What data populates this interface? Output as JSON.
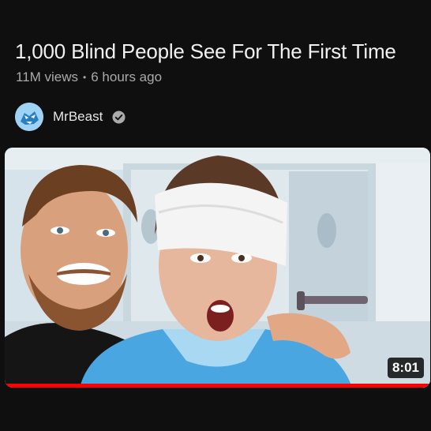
{
  "video": {
    "title": "1,000 Blind People See For The First Time",
    "views": "11M views",
    "separator": "•",
    "age": "6 hours ago",
    "duration": "8:01",
    "progress_fraction": 1.0
  },
  "channel": {
    "name": "MrBeast",
    "verified": true,
    "avatar_icon": "channel-avatar-icon",
    "verified_icon": "verified-check-icon"
  },
  "colors": {
    "background": "#0f0f0f",
    "progress": "#ff0000",
    "meta_text": "#aaaaaa"
  }
}
